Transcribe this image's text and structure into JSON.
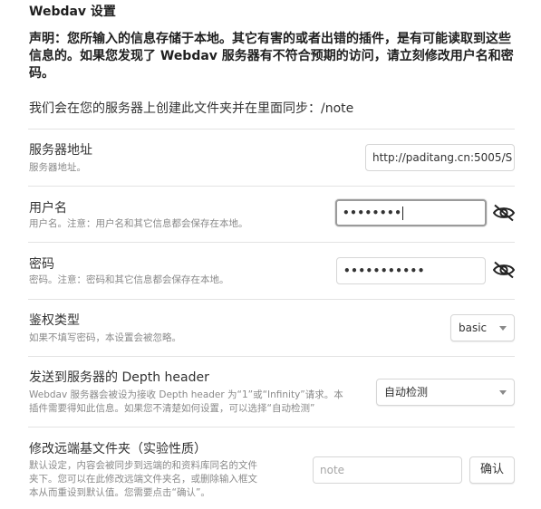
{
  "section_title": "Webdav 设置",
  "warning": "声明：您所输入的信息存储于本地。其它有害的或者出错的插件，是有可能读取到这些信息的。如果您发现了 Webdav 服务器有不符合预期的访问，请立刻修改用户名和密码。",
  "sync_note": "我们会在您的服务器上创建此文件夹并在里面同步：/note",
  "settings": {
    "server": {
      "title": "服务器地址",
      "desc": "服务器地址。",
      "value": "http://paditang.cn:5005/S"
    },
    "username": {
      "title": "用户名",
      "desc": "用户名。注意：用户名和其它信息都会保存在本地。",
      "masked_value": "••••••••"
    },
    "password": {
      "title": "密码",
      "desc": "密码。注意：密码和其它信息都会保存在本地。",
      "masked_value": "•••••••••••"
    },
    "auth": {
      "title": "鉴权类型",
      "desc": "如果不填写密码，本设置会被忽略。",
      "selected": "basic"
    },
    "depth": {
      "title": "发送到服务器的 Depth header",
      "desc_line1": "Webdav 服务器会被设为接收 Depth header 为“1”或“Infinity”请求。本",
      "desc_line2": "插件需要得知此信息。如果您不清楚如何设置，可以选择“自动检测”",
      "selected": "自动检测"
    },
    "remote_folder": {
      "title": "修改远端基文件夹（实验性质）",
      "desc_line1": "默认设定，内容会被同步到远端的和资料库同名的文件",
      "desc_line2": "夹下。您可以在此修改远端文件夹名，或删除输入框文",
      "desc_line3": "本从而重设到默认值。您需要点击“确认”。",
      "placeholder": "note",
      "confirm_label": "确认"
    }
  },
  "icons": {
    "toggle_visibility": "eye-off-icon",
    "dropdown": "chevron-down-icon"
  },
  "colors": {
    "text": "#333333",
    "muted": "#8a8a8a",
    "border": "#d6d6d6",
    "focus_border": "#9a9a9a"
  }
}
